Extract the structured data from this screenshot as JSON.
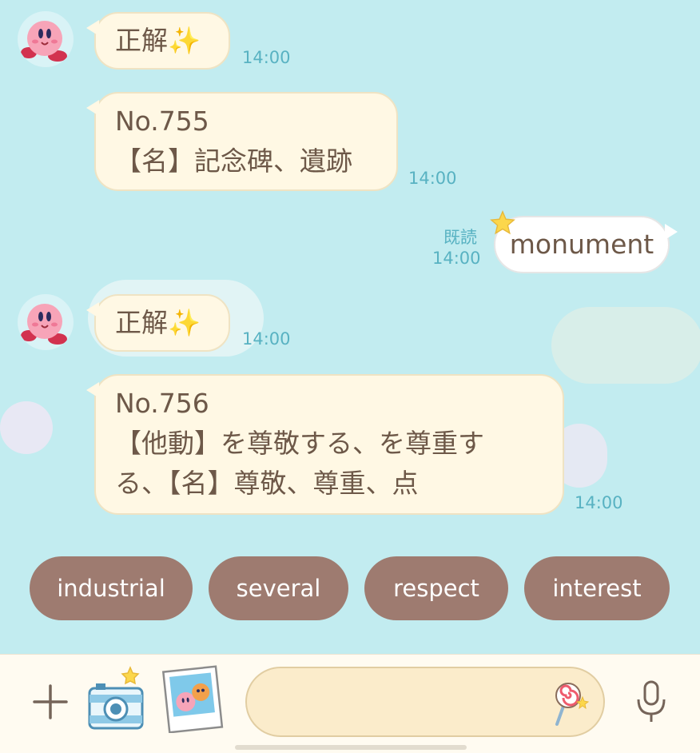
{
  "messages": [
    {
      "text": "正解✨",
      "time": "14:00"
    },
    {
      "lines": [
        "No.755",
        "【名】記念碑、遺跡"
      ],
      "time": "14:00"
    },
    {
      "text": "monument",
      "read": "既読",
      "time": "14:00"
    },
    {
      "text": "正解✨",
      "time": "14:00"
    },
    {
      "lines": [
        "No.756",
        "【他動】を尊敬する、を尊重す",
        "る、【名】尊敬、尊重、点"
      ],
      "time": "14:00"
    }
  ],
  "quick_replies": [
    "industrial",
    "several",
    "respect",
    "interest"
  ],
  "input": {
    "placeholder": ""
  },
  "icons": {
    "avatar": "kirby-avatar-icon",
    "add": "plus-icon",
    "camera": "camera-icon",
    "album": "photo-album-icon",
    "sticker": "lollipop-sticker-icon",
    "mic": "microphone-icon"
  },
  "colors": {
    "background": "#c2ecf0",
    "bubble_in": "#fff8e4",
    "bubble_out": "#ffffff",
    "chip": "#9e7b70",
    "time": "#58b2c2",
    "text": "#6d5848"
  }
}
